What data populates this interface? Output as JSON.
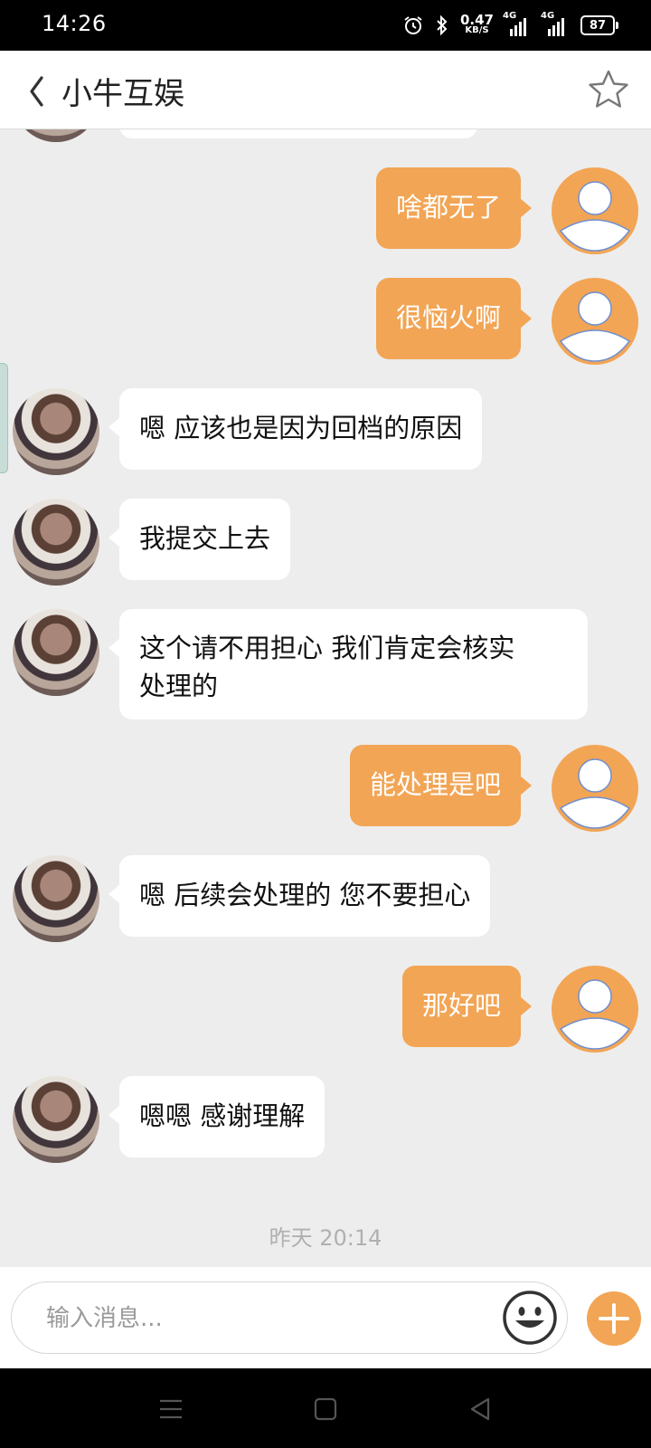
{
  "status_bar": {
    "time": "14:26",
    "speed_value": "0.47",
    "speed_unit": "KB/S",
    "net1": "4G",
    "net2": "4G",
    "battery": "87"
  },
  "header": {
    "title": "小牛互娱",
    "back_icon": "chevron-left-icon",
    "star_icon": "star-outline-icon"
  },
  "messages": [
    {
      "side": "out",
      "text": "啥都无了"
    },
    {
      "side": "out",
      "text": "很恼火啊"
    },
    {
      "side": "in",
      "text": "嗯  应该也是因为回档的原因"
    },
    {
      "side": "in",
      "text": "我提交上去"
    },
    {
      "side": "in",
      "text": "这个请不用担心  我们肯定会核实",
      "text2": "处理的"
    },
    {
      "side": "out",
      "text": "能处理是吧"
    },
    {
      "side": "in",
      "text": "嗯   后续会处理的  您不要担心"
    },
    {
      "side": "out",
      "text": "那好吧"
    },
    {
      "side": "in",
      "text": "嗯嗯 感谢理解"
    }
  ],
  "timestamp": "昨天 20:14",
  "input": {
    "placeholder": "输入消息...",
    "value": ""
  },
  "colors": {
    "accent": "#f2a555",
    "background": "#ededed"
  }
}
